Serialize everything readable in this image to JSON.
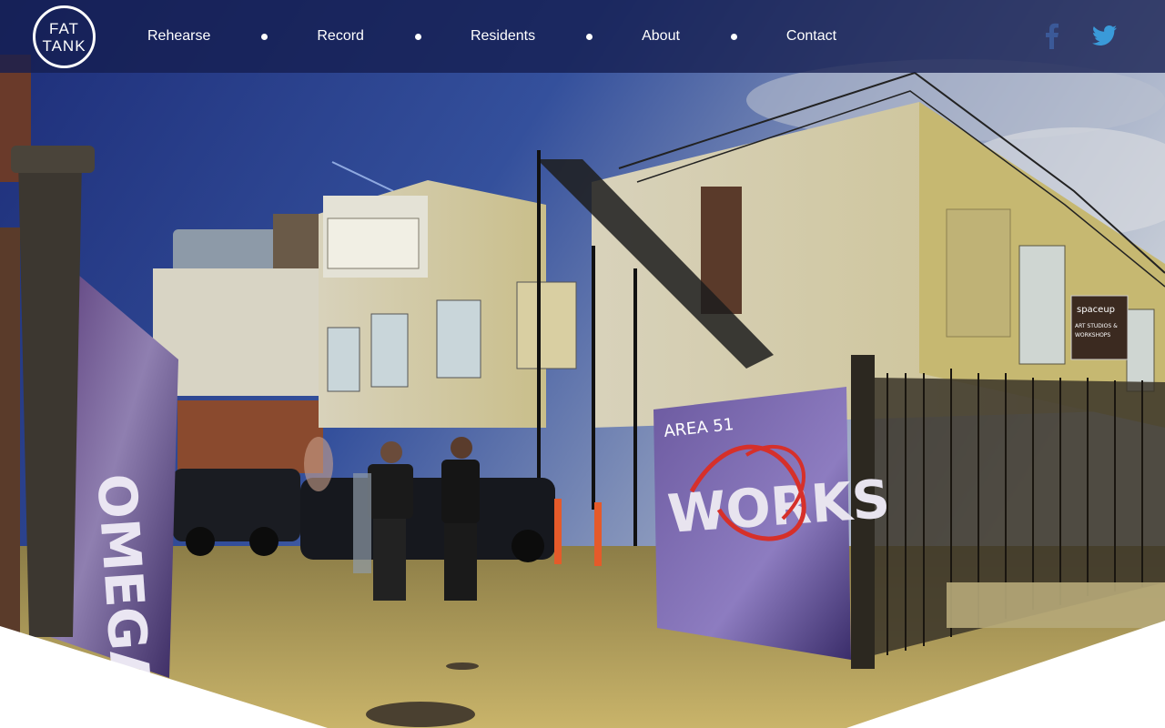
{
  "brand": {
    "logo_line1": "FAT",
    "logo_line2": "TANK"
  },
  "nav": {
    "items": [
      {
        "label": "Rehearse"
      },
      {
        "label": "Record"
      },
      {
        "label": "Residents"
      },
      {
        "label": "About"
      },
      {
        "label": "Contact"
      }
    ]
  },
  "social": {
    "facebook_icon": "facebook-icon",
    "twitter_icon": "twitter-icon",
    "facebook_color": "#3b5998",
    "twitter_color": "#3a9ad9"
  },
  "hero": {
    "signs": {
      "omega": "OMEGA",
      "spaceup_logo": "spaceup",
      "spaceup_text1": "ART STUDIOS &",
      "spaceup_text2": "WORKSHOPS",
      "graffiti": "WORKS",
      "graffiti_tag": "AREA 51"
    }
  },
  "colors": {
    "nav_bg": "#141e50",
    "sky": "#2b3e8f",
    "ground": "#b7a25a"
  }
}
